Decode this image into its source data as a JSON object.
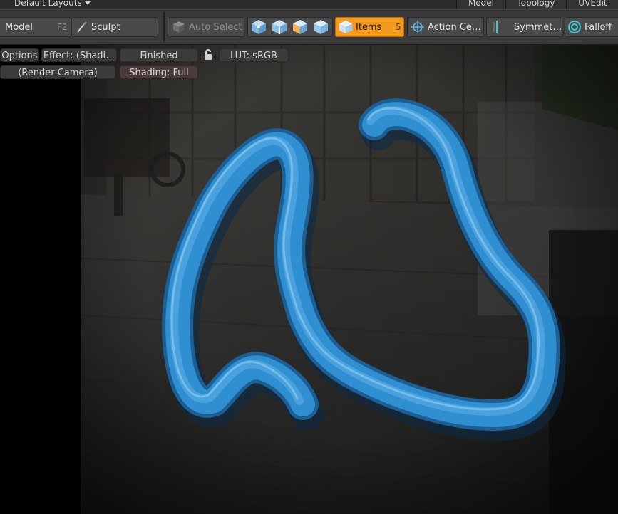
{
  "menubar": {
    "layout_label": "Default Layouts",
    "tabs": [
      "Model",
      "Topology",
      "UVEdit"
    ]
  },
  "toolbar": {
    "model_label": "Model",
    "model_shortcut": "F2",
    "sculpt_label": "Sculpt",
    "auto_select_label": "Auto Select",
    "items_label": "Items",
    "items_shortcut": "5",
    "action_center_label": "Action Ce…",
    "symmetry_label": "Symmet…",
    "falloff_label": "Falloff"
  },
  "viewport": {
    "options_label": "Options",
    "effect_label": "Effect: (Shadi…",
    "finished_label": "Finished",
    "lut_label": "LUT: sRGB",
    "camera_label": "(Render Camera)",
    "shading_label": "Shading: Full"
  },
  "colors": {
    "accent_active": "#f39a1f",
    "tube": "#2f8fd0",
    "falloff_ring": "#3ec7d6"
  },
  "icons": [
    "sculpt-brush-icon",
    "auto-select-cube-icon",
    "vertex-cube-icon",
    "edge-cube-icon",
    "polygon-cube-icon",
    "material-cube-icon",
    "items-cube-icon",
    "action-center-crosshair-icon",
    "symmetry-icon",
    "falloff-ring-icon",
    "lock-open-icon"
  ]
}
